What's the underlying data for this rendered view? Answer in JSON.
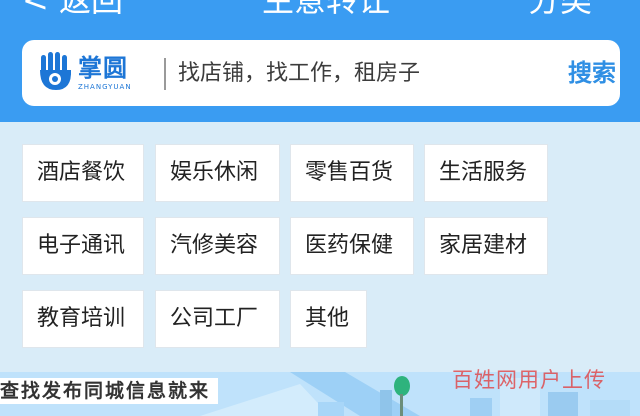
{
  "header": {
    "back_label": "< 返回",
    "title": "生意转让",
    "share_label": "分类"
  },
  "search": {
    "logo_text": "掌圆",
    "logo_subtext": "ZHANGYUAN",
    "placeholder": "找店铺，找工作，租房子",
    "button_label": "搜索"
  },
  "categories": [
    {
      "label": "酒店餐饮"
    },
    {
      "label": "娱乐休闲"
    },
    {
      "label": "零售百货"
    },
    {
      "label": "生活服务"
    },
    {
      "label": "电子通讯"
    },
    {
      "label": "汽修美容"
    },
    {
      "label": "医药保健"
    },
    {
      "label": "家居建材"
    },
    {
      "label": "教育培训"
    },
    {
      "label": "公司工厂"
    },
    {
      "label": "其他"
    }
  ],
  "banner": {
    "text": "查找发布同城信息就来"
  },
  "watermark": "百姓网用户上传",
  "colors": {
    "header_bg": "#3a9cf2",
    "page_bg": "#d9ecf8",
    "accent": "#2f8fe4"
  }
}
